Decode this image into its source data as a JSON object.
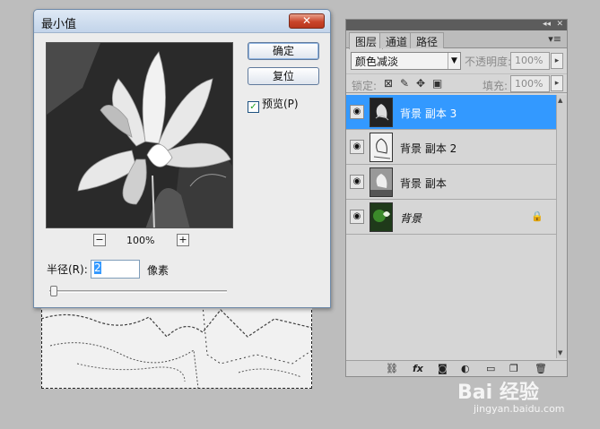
{
  "dialog": {
    "title": "最小值",
    "close_glyph": "✕",
    "ok_label": "确定",
    "reset_label": "复位",
    "preview_label": "预览(P)",
    "preview_checked": true,
    "zoom_out": "−",
    "zoom_in": "+",
    "zoom_value": "100%",
    "radius_label": "半径(R):",
    "radius_value": "2",
    "radius_unit": "像素"
  },
  "layers_panel": {
    "collapse_glyph": "◂◂",
    "close_glyph": "✕",
    "tabs": [
      "图层",
      "通道",
      "路径"
    ],
    "active_tab": "图层",
    "menu_icon": "▾≡",
    "blend_mode": "颜色减淡",
    "opacity_label": "不透明度:",
    "opacity_value": "100%",
    "lock_label": "锁定:",
    "fill_label": "填充:",
    "fill_value": "100%",
    "layers": [
      {
        "name": "背景 副本 3",
        "selected": true
      },
      {
        "name": "背景 副本 2",
        "selected": false
      },
      {
        "name": "背景 副本",
        "selected": false
      },
      {
        "name": "背景",
        "selected": false,
        "locked": true
      }
    ],
    "bottom_icons": [
      "link-icon",
      "fx-icon",
      "mask-icon",
      "adjustment-icon",
      "group-icon",
      "new-layer-icon",
      "trash-icon"
    ]
  },
  "watermark": {
    "logo": "Bai  经验",
    "url": "jingyan.baidu.com"
  },
  "colors": {
    "selected_layer": "#3399ff",
    "panel_bg": "#d6d6d6",
    "dialog_bg": "#ececec",
    "workspace": "#bdbdbd"
  }
}
